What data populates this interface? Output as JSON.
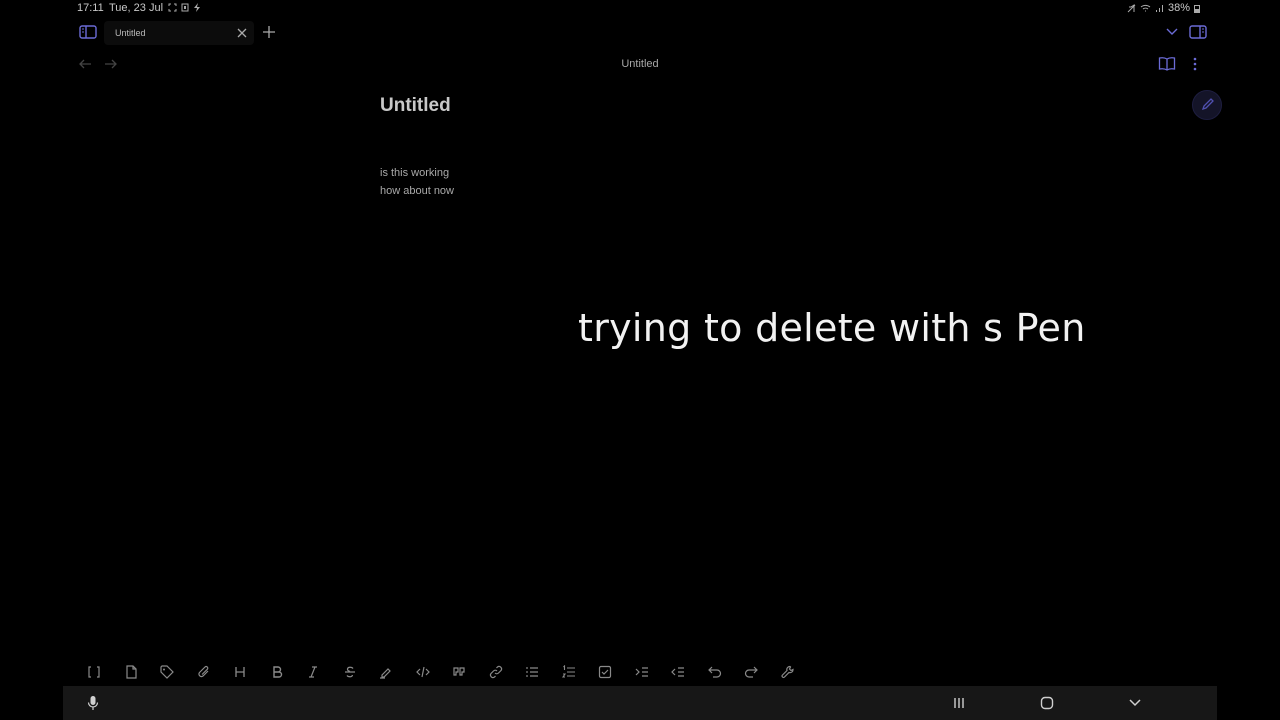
{
  "status_bar": {
    "time": "17:11",
    "date": "Tue, 23 Jul",
    "battery": "38%"
  },
  "tab": {
    "label": "Untitled"
  },
  "nav": {
    "title": "Untitled"
  },
  "note": {
    "title": "Untitled",
    "lines": [
      "is this working",
      "how about now"
    ]
  },
  "caption": "trying to delete with s Pen",
  "toolbar_buttons": [
    "brackets-icon",
    "file-icon",
    "tag-icon",
    "paperclip-icon",
    "heading-icon",
    "bold-icon",
    "italic-icon",
    "strikethrough-icon",
    "highlight-icon",
    "code-icon",
    "quote-icon",
    "link-icon",
    "bullet-list-icon",
    "numbered-list-icon",
    "checkbox-icon",
    "indent-icon",
    "outdent-icon",
    "undo-icon",
    "redo-icon",
    "wrench-icon"
  ],
  "colors": {
    "accent": "#6b6bd6",
    "background": "#000000"
  }
}
